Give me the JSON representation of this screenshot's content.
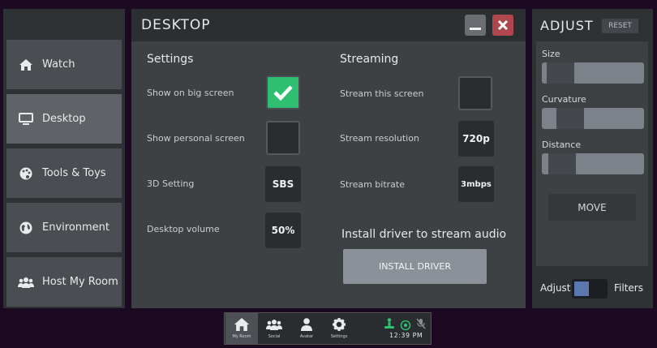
{
  "nav": {
    "items": [
      {
        "label": "Watch",
        "icon": "home-icon"
      },
      {
        "label": "Desktop",
        "icon": "monitor-icon"
      },
      {
        "label": "Tools & Toys",
        "icon": "palette-icon"
      },
      {
        "label": "Environment",
        "icon": "globe-icon"
      },
      {
        "label": "Host My Room",
        "icon": "people-icon"
      }
    ],
    "active": "Desktop"
  },
  "desktop": {
    "title": "DESKTOP",
    "settings": {
      "heading": "Settings",
      "show_big_label": "Show on big screen",
      "show_big_checked": true,
      "show_personal_label": "Show personal screen",
      "show_personal_checked": false,
      "setting3d_label": "3D Setting",
      "setting3d_value": "SBS",
      "volume_label": "Desktop volume",
      "volume_value": "50%"
    },
    "streaming": {
      "heading": "Streaming",
      "stream_label": "Stream this screen",
      "stream_checked": false,
      "resolution_label": "Stream resolution",
      "resolution_value": "720p",
      "bitrate_label": "Stream bitrate",
      "bitrate_value": "3mbps",
      "install_hint": "Install driver to stream audio",
      "install_button": "INSTALL DRIVER"
    }
  },
  "adjust": {
    "title": "ADJUST",
    "reset": "RESET",
    "size_label": "Size",
    "curvature_label": "Curvature",
    "distance_label": "Distance",
    "move": "MOVE",
    "toggle_left": "Adjust",
    "toggle_right": "Filters"
  },
  "dock": {
    "items": [
      {
        "label": "My Room",
        "icon": "home-icon"
      },
      {
        "label": "Social",
        "icon": "people-icon"
      },
      {
        "label": "Avatar",
        "icon": "person-icon"
      },
      {
        "label": "Settings",
        "icon": "gear-icon"
      }
    ],
    "time": "12:39 PM"
  },
  "colors": {
    "accent_green": "#2fbf71",
    "close_red": "#b0474c",
    "background": "#1b0a22"
  }
}
